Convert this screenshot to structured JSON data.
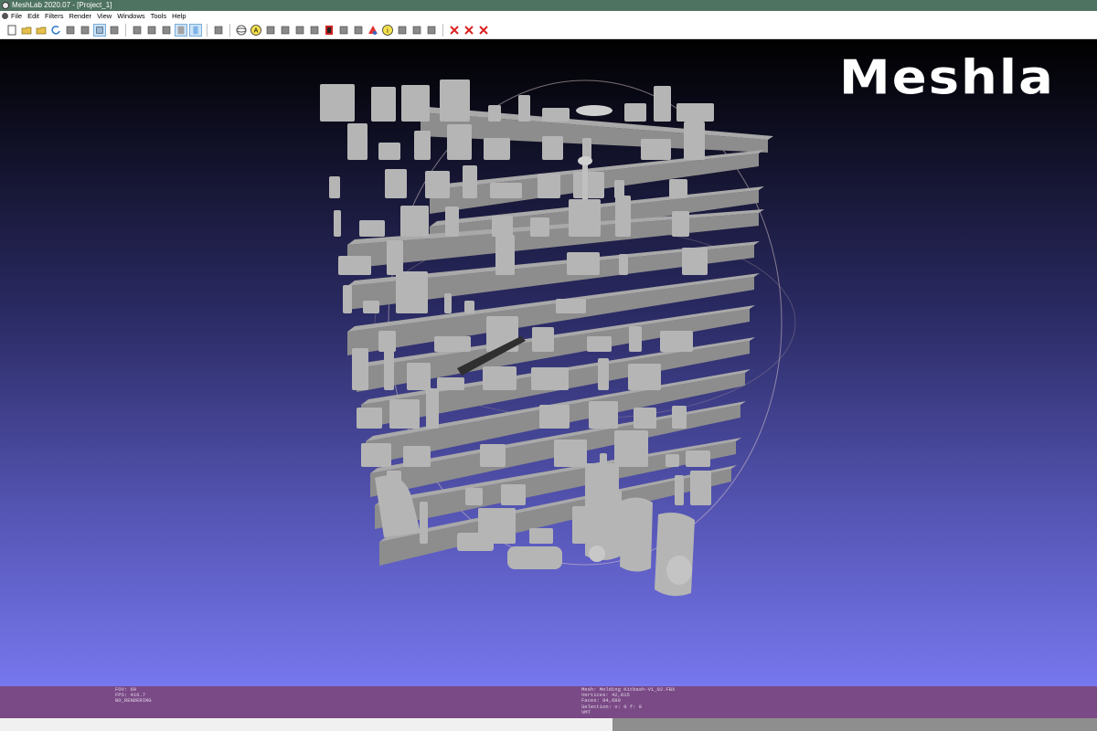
{
  "window": {
    "title": "MeshLab 2020.07 - [Project_1]"
  },
  "menu": [
    "File",
    "Edit",
    "Filters",
    "Render",
    "View",
    "Windows",
    "Tools",
    "Help"
  ],
  "toolbar": {
    "buttons": [
      {
        "name": "new-project-icon"
      },
      {
        "name": "open-project-icon"
      },
      {
        "name": "open-folder-icon"
      },
      {
        "name": "reload-icon"
      },
      {
        "name": "save-snapshot-icon"
      },
      {
        "name": "screenshot-icon"
      },
      {
        "name": "layer-dialog-icon",
        "active": true
      },
      {
        "name": "raster-icon"
      },
      {
        "sep": true
      },
      {
        "name": "bounding-box-icon"
      },
      {
        "name": "points-icon"
      },
      {
        "name": "wireframe-icon"
      },
      {
        "name": "flat-icon",
        "active": true
      },
      {
        "name": "smooth-icon",
        "active": true
      },
      {
        "sep": true
      },
      {
        "name": "lighting-icon"
      },
      {
        "sep": true
      },
      {
        "name": "trackball-icon"
      },
      {
        "name": "annotation-a-icon"
      },
      {
        "name": "axes-icon"
      },
      {
        "name": "paint-icon"
      },
      {
        "name": "select-vertex-icon"
      },
      {
        "name": "brush-icon"
      },
      {
        "name": "red-tool-icon"
      },
      {
        "name": "select-faces-icon"
      },
      {
        "name": "measure-icon"
      },
      {
        "name": "color-tool-icon"
      },
      {
        "name": "info-icon"
      },
      {
        "name": "pick-points-icon"
      },
      {
        "name": "align-icon"
      },
      {
        "name": "select-cursor-icon"
      },
      {
        "sep": true
      },
      {
        "name": "delete-vertices-icon"
      },
      {
        "name": "delete-faces-icon"
      },
      {
        "name": "delete-all-icon"
      }
    ]
  },
  "colors": {
    "titlebar": "#4f7361",
    "viewport_top": "#000000",
    "viewport_bottom": "#7777ee",
    "statusbar": "#7a4a86",
    "mesh": "#b5b5b5"
  },
  "viewport": {
    "watermark": "Meshla"
  },
  "status": {
    "left": [
      "FOV: 60",
      "FPS:   416.7",
      "BO_RENDERING"
    ],
    "right": [
      "Mesh: Molding Kitbash-V1_02.FBX",
      "Vertices: 42,815",
      "Faces: 84,680",
      "Selection: v: 0 f: 0",
      "VMT"
    ]
  }
}
